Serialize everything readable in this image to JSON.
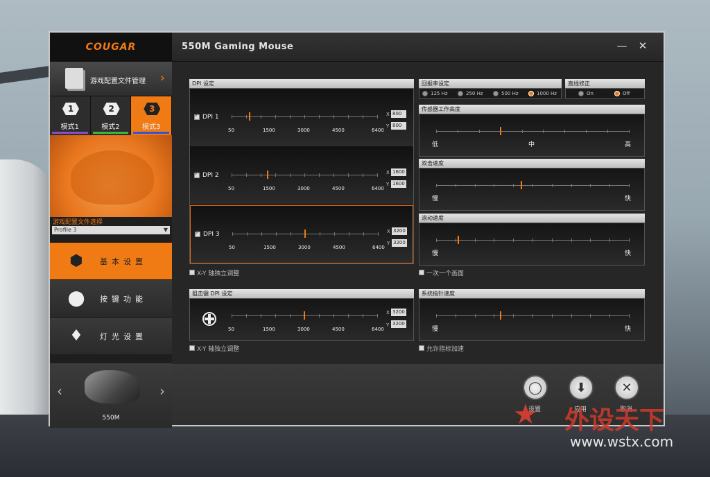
{
  "window": {
    "title": "550M Gaming Mouse",
    "minimize": "—",
    "close": "✕"
  },
  "brand": {
    "logo": "COUGAR"
  },
  "sidebar": {
    "profile_manager": "游戏配置文件管理",
    "modes": [
      {
        "num": "1",
        "label": "模式1",
        "color": "#8a4cc8"
      },
      {
        "num": "2",
        "label": "模式2",
        "color": "#3db53b"
      },
      {
        "num": "3",
        "label": "模式3",
        "color": "#3454d1"
      }
    ],
    "profile_select_label": "游戏配置文件选择",
    "profile_select_value": "Profile 3",
    "nav": [
      {
        "label": "基本设置",
        "icon": "hexagon-icon"
      },
      {
        "label": "按键功能",
        "icon": "buttons-icon"
      },
      {
        "label": "灯光设置",
        "icon": "bulb-icon"
      }
    ],
    "device": {
      "name": "550M",
      "prev": "‹",
      "next": "›"
    }
  },
  "dpi": {
    "header": "DPI 设定",
    "scale": [
      "50",
      "1500",
      "3000",
      "4500",
      "6400"
    ],
    "rows": [
      {
        "name": "DPI 1",
        "checked": true,
        "x": "800",
        "y": "800",
        "pos": 0.118
      },
      {
        "name": "DPI 2",
        "checked": true,
        "x": "1600",
        "y": "1600",
        "pos": 0.244
      },
      {
        "name": "DPI 3",
        "checked": true,
        "x": "3200",
        "y": "3200",
        "pos": 0.496
      }
    ],
    "independent_label": "X-Y 轴独立调整"
  },
  "sniper": {
    "header": "狙击键 DPI 设定",
    "x": "3200",
    "y": "3200",
    "pos": 0.496,
    "independent_label": "X-Y 轴独立调整"
  },
  "polling": {
    "header": "回报率设定",
    "options": [
      "125 Hz",
      "250 Hz",
      "500 Hz",
      "1000 Hz"
    ],
    "selected": "1000 Hz"
  },
  "angle_snap": {
    "header": "直线修正",
    "options": [
      "On",
      "Off"
    ],
    "selected": "Off"
  },
  "lift_off": {
    "header": "传感器工作高度",
    "labels": [
      "低",
      "中",
      "高"
    ],
    "pos": 0.33
  },
  "double_click": {
    "header": "双击速度",
    "labels": [
      "慢",
      "快"
    ],
    "pos": 0.44
  },
  "scroll": {
    "header": "滚动速度",
    "labels": [
      "慢",
      "快"
    ],
    "pos": 0.11
  },
  "scroll_page_label": "一次一个画面",
  "pointer": {
    "header": "系统指针速度",
    "labels": [
      "慢",
      "快"
    ],
    "pos": 0.33
  },
  "accel_label": "允许指标加速",
  "actions": [
    {
      "label": "设置",
      "icon": "reset-icon"
    },
    {
      "label": "应用",
      "icon": "apply-icon"
    },
    {
      "label": "取消",
      "icon": "cancel-icon"
    }
  ],
  "watermark": {
    "brand": "外设天下",
    "url": "www.wstx.com"
  }
}
